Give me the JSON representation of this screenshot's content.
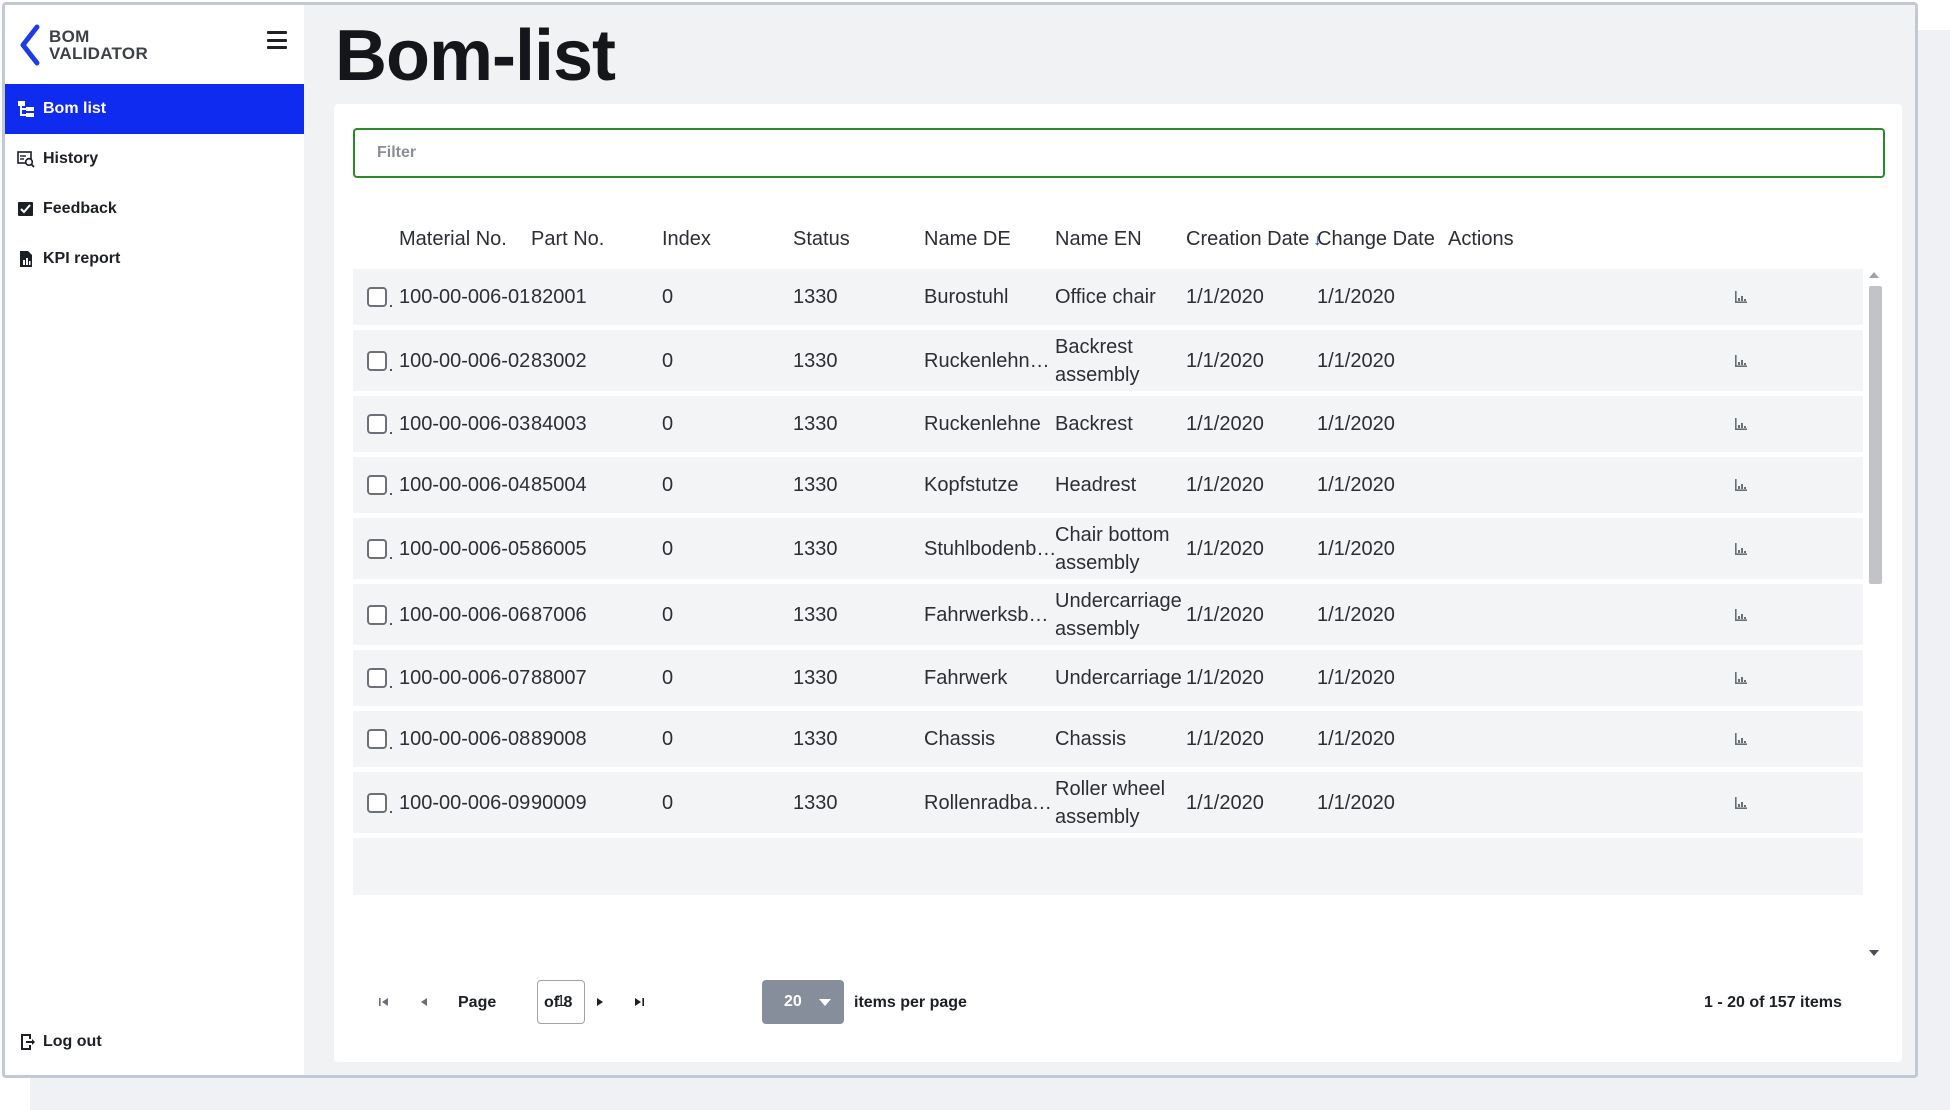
{
  "app": {
    "logo_line1": "BOM",
    "logo_line2": "VALIDATOR",
    "page_title": "Bom-list"
  },
  "sidebar": {
    "items": [
      {
        "label": "Bom list",
        "icon": "tree-list-icon",
        "active": true
      },
      {
        "label": "History",
        "icon": "history-search-icon",
        "active": false
      },
      {
        "label": "Feedback",
        "icon": "feedback-check-icon",
        "active": false
      },
      {
        "label": "KPI report",
        "icon": "report-chart-icon",
        "active": false
      }
    ],
    "logout_label": "Log out"
  },
  "filter": {
    "placeholder": "Filter",
    "value": ""
  },
  "table": {
    "columns": [
      "Material No.",
      "Part No.",
      "Index",
      "Status",
      "Name DE",
      "Name EN",
      "Creation Date",
      "Change Date",
      "Actions"
    ],
    "sorted_column": "Creation Date",
    "sort_direction": "descending",
    "rows": [
      {
        "material_no": "100-00-006-01",
        "part_no": "82001",
        "index": "0",
        "status": "1330",
        "name_de": "Burostuhl",
        "name_en": "Office chair",
        "creation_date": "1/1/2020",
        "change_date": "1/1/2020"
      },
      {
        "material_no": "100-00-006-02",
        "part_no": "83002",
        "index": "0",
        "status": "1330",
        "name_de": "Ruckenlehn…",
        "name_en": "Backrest assembly",
        "creation_date": "1/1/2020",
        "change_date": "1/1/2020"
      },
      {
        "material_no": "100-00-006-03",
        "part_no": "84003",
        "index": "0",
        "status": "1330",
        "name_de": "Ruckenlehne",
        "name_en": "Backrest",
        "creation_date": "1/1/2020",
        "change_date": "1/1/2020"
      },
      {
        "material_no": "100-00-006-04",
        "part_no": "85004",
        "index": "0",
        "status": "1330",
        "name_de": "Kopfstutze",
        "name_en": "Headrest",
        "creation_date": "1/1/2020",
        "change_date": "1/1/2020"
      },
      {
        "material_no": "100-00-006-05",
        "part_no": "86005",
        "index": "0",
        "status": "1330",
        "name_de": "Stuhlbodenb…",
        "name_en": "Chair bottom assembly",
        "creation_date": "1/1/2020",
        "change_date": "1/1/2020"
      },
      {
        "material_no": "100-00-006-06",
        "part_no": "87006",
        "index": "0",
        "status": "1330",
        "name_de": "Fahrwerksb…",
        "name_en": "Undercarriage assembly",
        "creation_date": "1/1/2020",
        "change_date": "1/1/2020"
      },
      {
        "material_no": "100-00-006-07",
        "part_no": "88007",
        "index": "0",
        "status": "1330",
        "name_de": "Fahrwerk",
        "name_en": "Undercarriage",
        "creation_date": "1/1/2020",
        "change_date": "1/1/2020"
      },
      {
        "material_no": "100-00-006-08",
        "part_no": "89008",
        "index": "0",
        "status": "1330",
        "name_de": "Chassis",
        "name_en": "Chassis",
        "creation_date": "1/1/2020",
        "change_date": "1/1/2020"
      },
      {
        "material_no": "100-00-006-09",
        "part_no": "90009",
        "index": "0",
        "status": "1330",
        "name_de": "Rollenradba…",
        "name_en": "Roller wheel assembly",
        "creation_date": "1/1/2020",
        "change_date": "1/1/2020"
      }
    ],
    "action_icon": "bar-chart-icon"
  },
  "pager": {
    "page_label": "Page",
    "current_page": "1",
    "of_label": "of 8",
    "page_size": "20",
    "items_per_page_label": "items per page",
    "summary": "1 - 20 of 157 items"
  },
  "colors": {
    "accent": "#0f2bef",
    "filter_border": "#2a8a2a",
    "row_bg": "#f3f4f6",
    "page_size_bg": "#868d9b"
  }
}
